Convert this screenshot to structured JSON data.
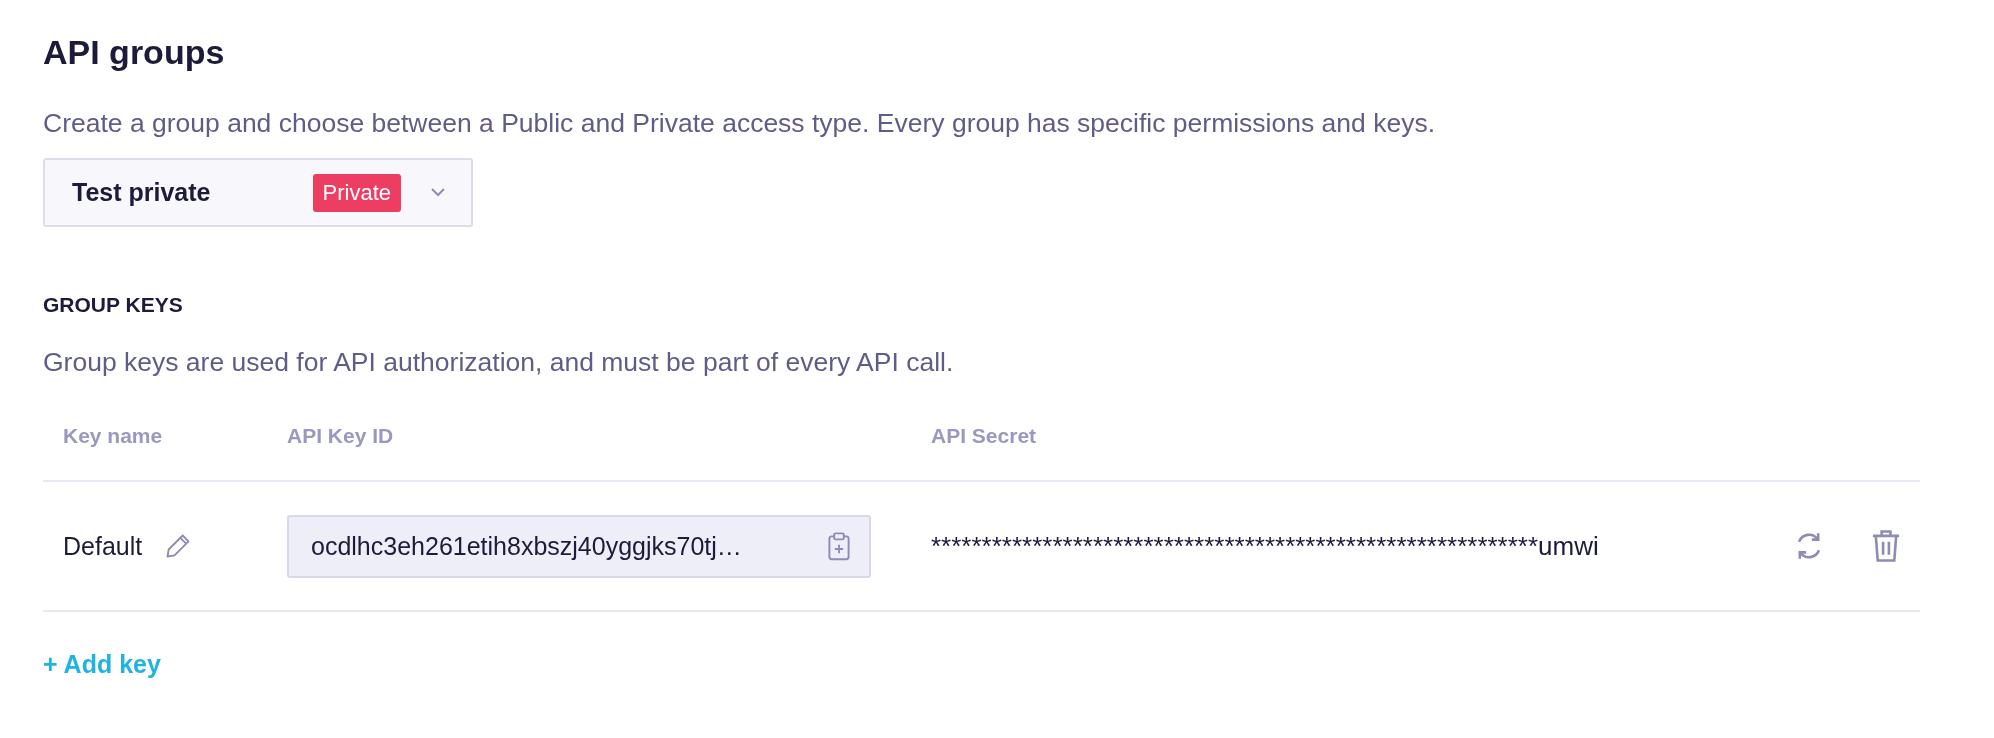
{
  "title": "API groups",
  "description": "Create a group and choose between a Public and Private access type. Every group has specific permissions and keys.",
  "group_select": {
    "value": "Test private",
    "badge": "Private",
    "kind": "private"
  },
  "group_keys": {
    "heading": "GROUP KEYS",
    "description": "Group keys are used for API authorization, and must be part of every API call.",
    "columns": [
      "Key name",
      "API Key ID",
      "API Secret"
    ],
    "rows": [
      {
        "name": "Default",
        "key_id": "ocdlhc3eh261etih8xbszj40yggjks70tj…",
        "secret": "************************************************************umwi"
      }
    ],
    "add_link": "+ Add key"
  }
}
